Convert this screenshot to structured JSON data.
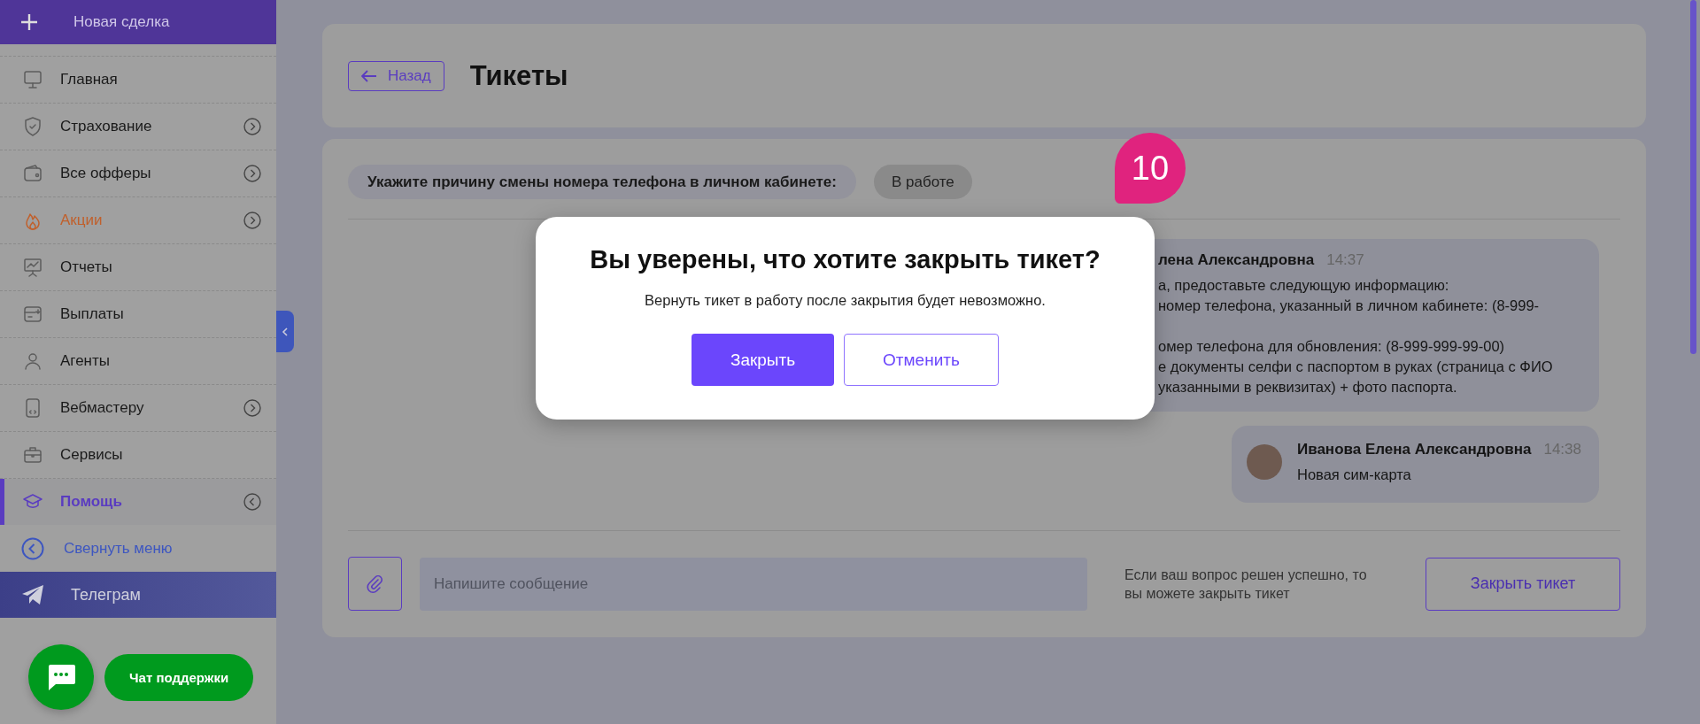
{
  "sidebar": {
    "new_deal": {
      "label": "Новая сделка"
    },
    "items": [
      {
        "label": "Главная",
        "kind": "normal",
        "selected": false,
        "has_submenu": false,
        "expanded": false
      },
      {
        "label": "Страхование",
        "kind": "normal",
        "selected": false,
        "has_submenu": true,
        "expanded": false
      },
      {
        "label": "Все офферы",
        "kind": "normal",
        "selected": false,
        "has_submenu": true,
        "expanded": false
      },
      {
        "label": "Акции",
        "kind": "promo",
        "selected": false,
        "has_submenu": true,
        "expanded": false
      },
      {
        "label": "Отчеты",
        "kind": "normal",
        "selected": false,
        "has_submenu": false,
        "expanded": false
      },
      {
        "label": "Выплаты",
        "kind": "normal",
        "selected": false,
        "has_submenu": false,
        "expanded": false
      },
      {
        "label": "Агенты",
        "kind": "normal",
        "selected": false,
        "has_submenu": false,
        "expanded": false
      },
      {
        "label": "Вебмастеру",
        "kind": "normal",
        "selected": false,
        "has_submenu": true,
        "expanded": false
      },
      {
        "label": "Сервисы",
        "kind": "normal",
        "selected": false,
        "has_submenu": false,
        "expanded": false
      },
      {
        "label": "Помощь",
        "kind": "normal",
        "selected": true,
        "has_submenu": true,
        "expanded": true
      }
    ],
    "collapse": {
      "label": "Свернуть меню"
    },
    "telegram": {
      "label": "Телеграм"
    }
  },
  "support_chat": {
    "label": "Чат поддержки"
  },
  "header": {
    "back": "Назад",
    "title": "Тикеты"
  },
  "ticket": {
    "subject": "Укажите причину смены номера телефона в личном кабинете:",
    "status": "В работе",
    "messages": [
      {
        "author": "лена Александровна",
        "time": "14:37",
        "avatar": false,
        "paragraphs": [
          [
            "а, предоставьте следующую информацию:",
            "номер телефона, указанный в личном кабинете: (8-999-"
          ],
          [
            "омер телефона для обновления: (8-999-999-99-00)",
            "е документы селфи с паспортом в руках (страница с ФИО",
            "указанными в реквизитах) + фото паспорта."
          ]
        ]
      },
      {
        "author": "Иванова Елена Александровна",
        "time": "14:38",
        "avatar": true,
        "paragraphs": [
          [
            "Новая сим-карта"
          ]
        ]
      }
    ]
  },
  "composer": {
    "placeholder": "Напишите сообщение",
    "hint": "Если ваш вопрос решен успешно, то вы можете закрыть тикет",
    "close_button": "Закрыть тикет"
  },
  "dialog": {
    "title": "Вы уверены, что хотите закрыть тикет?",
    "text": "Вернуть тикет в работу после закрытия будет невозможно.",
    "buttons": [
      {
        "label": "Закрыть",
        "kind": "primary"
      },
      {
        "label": "Отменить",
        "kind": "secondary"
      }
    ]
  },
  "annotation_badge": "10"
}
